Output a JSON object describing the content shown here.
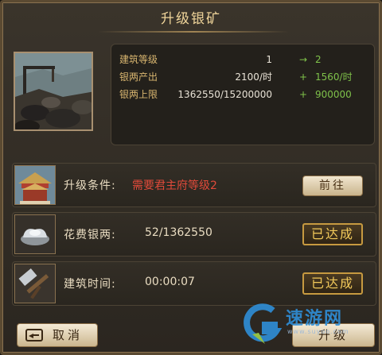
{
  "title": "升级银矿",
  "info": {
    "rows": [
      {
        "label": "建筑等级",
        "current": "1",
        "op": "→",
        "next": "2"
      },
      {
        "label": "银两产出",
        "current": "2100/时",
        "op": "+",
        "next": "1560/时"
      },
      {
        "label": "银两上限",
        "current": "1362550/15200000",
        "op": "+",
        "next": "900000"
      }
    ]
  },
  "conditions": [
    {
      "label": "升级条件:",
      "value": "需要君主府等级2",
      "value_color": "#e04a3a",
      "button": "前往",
      "button_style": "go",
      "icon": "palace-icon"
    },
    {
      "label": "花费银两:",
      "value": "52/1362550",
      "value_color": "#e9dcc1",
      "button": "已达成",
      "button_style": "done",
      "icon": "silver-ingot-icon"
    },
    {
      "label": "建筑时间:",
      "value": "00:00:07",
      "value_color": "#e9dcc1",
      "button": "已达成",
      "button_style": "done",
      "icon": "hammer-icon"
    }
  ],
  "buttons": {
    "cancel": "取消",
    "upgrade": "升级"
  },
  "watermark": {
    "text": "速游网",
    "sub": "www.suyoo.com"
  },
  "colors": {
    "accent_gold": "#f0d59a",
    "increase_green": "#7fc24a",
    "warning_red": "#e04a3a"
  }
}
